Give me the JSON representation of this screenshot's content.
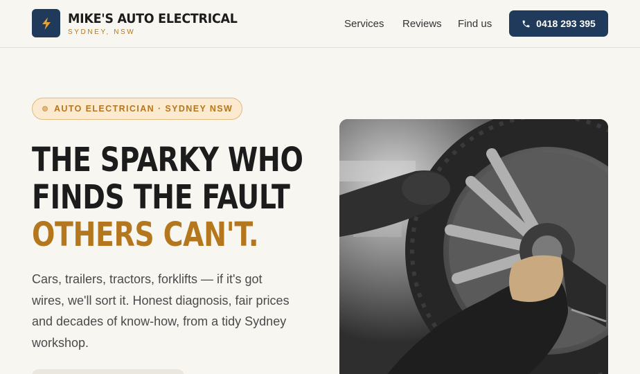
{
  "brand": {
    "name": "MIKE'S AUTO ELECTRICAL",
    "location": "SYDNEY, NSW",
    "logo_icon": "lightning-bolt-icon"
  },
  "nav": {
    "items": [
      {
        "label": "Services"
      },
      {
        "label": "Reviews"
      },
      {
        "label": "Find us"
      }
    ],
    "phone": "0418 293 395",
    "phone_icon": "phone-icon"
  },
  "hero": {
    "eyebrow": "AUTO ELECTRICIAN · SYDNEY NSW",
    "headline_line1": "THE SPARKY WHO",
    "headline_line2": "FINDS THE FAULT",
    "headline_line3": "OTHERS CAN'T.",
    "description": "Cars, trailers, tractors, forklifts — if it's got wires, we'll sort it. Honest diagnosis, fair prices and decades of know-how, from a tidy Sydney workshop."
  },
  "colors": {
    "navy": "#1f3a5a",
    "amber": "#b5771d",
    "background": "#f8f6f1"
  }
}
